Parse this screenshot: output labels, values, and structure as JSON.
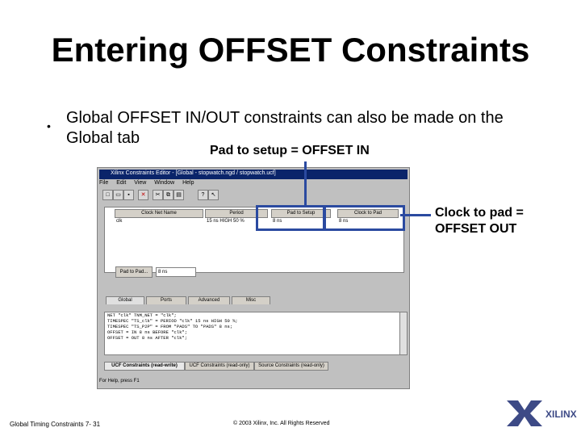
{
  "slide": {
    "title": "Entering OFFSET Constraints",
    "bullet_marker": "•",
    "bullet_text": "Global OFFSET IN/OUT constraints can also be made on the Global tab",
    "callout_setup": "Pad to setup = OFFSET IN",
    "callout_pad": "Clock to pad = OFFSET OUT",
    "footer_left": "Global Timing Constraints 7- 31",
    "footer_center": "© 2003 Xilinx, Inc. All Rights Reserved",
    "logo_text": "XILINX"
  },
  "window": {
    "title": "Xilinx Constraints Editor - [Global - stopwatch.ngd / stopwatch.ucf]",
    "menu": [
      "File",
      "Edit",
      "View",
      "Window",
      "Help"
    ],
    "grid_headers": [
      "Clock Net Name",
      "Period",
      "Pad to Setup",
      "Clock to Pad"
    ],
    "grid_row": [
      "clk",
      "15 ns HIGH 50 %",
      "8 ns",
      "8 ns"
    ],
    "pad_to_pad_label": "Pad to Pad...",
    "pad_to_pad_value": "8 ns",
    "tabs": [
      "Global",
      "Ports",
      "Advanced",
      "Misc"
    ],
    "log_lines": [
      "NET \"clk\" TNM_NET = \"clk\";",
      "TIMESPEC \"TS_clk\" = PERIOD \"clk\" 15 ns HIGH 50 %;",
      "TIMESPEC \"TS_P2P\" = FROM \"PADS\" TO \"PADS\" 8 ns;",
      "OFFSET = IN 8 ns BEFORE \"clk\";",
      "OFFSET = OUT 8 ns AFTER \"clk\";"
    ],
    "bottom_tabs": [
      "UCF Constraints (read-write)",
      "UCF Constraints (read-only)",
      "Source Constraints (read-only)"
    ],
    "status": "For Help, press F1"
  },
  "colors": {
    "callout_blue": "#2b4aa0",
    "titlebar": "#0a246a"
  }
}
